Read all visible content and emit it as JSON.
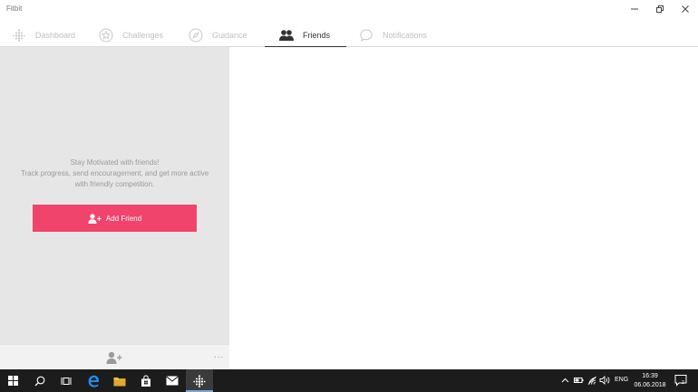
{
  "window": {
    "title": "Fitbit"
  },
  "nav": {
    "tabs": [
      {
        "label": "Dashboard",
        "icon": "dots-grid-icon",
        "active": false
      },
      {
        "label": "Challenges",
        "icon": "star-badge-icon",
        "active": false
      },
      {
        "label": "Guidance",
        "icon": "compass-icon",
        "active": false
      },
      {
        "label": "Friends",
        "icon": "friends-icon",
        "active": true
      },
      {
        "label": "Notifications",
        "icon": "chat-bubble-icon",
        "active": false
      }
    ]
  },
  "friends": {
    "empty_title": "Stay Motivated with friends!",
    "empty_line2": "Track progress, send encouragement, and get more active",
    "empty_line3": "with friendly competition.",
    "add_button": "Add Friend",
    "more": "..."
  },
  "taskbar": {
    "language": "ENG",
    "time": "16:39",
    "date": "06.06.2018",
    "notification_count": "2"
  },
  "colors": {
    "accent": "#f0446d",
    "panel_bg": "#e6e6e6",
    "taskbar_bg": "#1c1c1c"
  }
}
